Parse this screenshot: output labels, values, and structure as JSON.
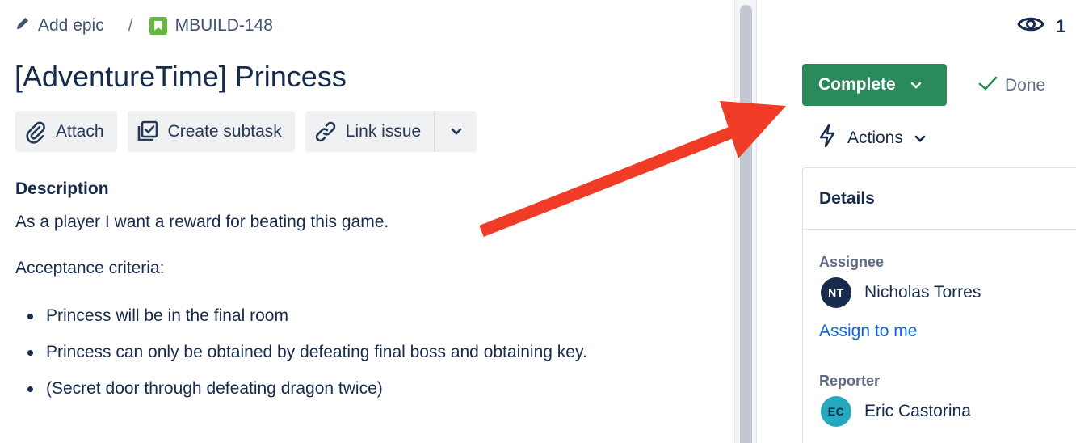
{
  "breadcrumb": {
    "add_epic": "Add epic",
    "separator": "/",
    "issue_key": "MBUILD-148"
  },
  "issue": {
    "title": "[AdventureTime] Princess"
  },
  "toolbar": {
    "attach": "Attach",
    "create_subtask": "Create subtask",
    "link_issue": "Link issue"
  },
  "description": {
    "heading": "Description",
    "summary": "As a player I want a reward for beating this game.",
    "criteria_label": "Acceptance criteria:",
    "criteria": [
      "Princess will be in the final room",
      "Princess can only be obtained by defeating final boss and obtaining key.",
      "(Secret door through defeating dragon twice)"
    ]
  },
  "watchers": {
    "count": "1",
    "icon": "eye-icon"
  },
  "status": {
    "complete_label": "Complete",
    "done_label": "Done",
    "actions_label": "Actions"
  },
  "details": {
    "heading": "Details",
    "assignee_label": "Assignee",
    "assignee_name": "Nicholas Torres",
    "assignee_initials": "NT",
    "assign_to_me": "Assign to me",
    "reporter_label": "Reporter",
    "reporter_name": "Eric Castorina",
    "reporter_initials": "EC"
  },
  "colors": {
    "complete_button": "#2A8A5C",
    "story_icon": "#63BA3C",
    "link": "#0C66E4",
    "annotation_arrow": "#F03C26",
    "assignee_avatar": "#172B4D",
    "reporter_avatar": "#26A9BE"
  }
}
